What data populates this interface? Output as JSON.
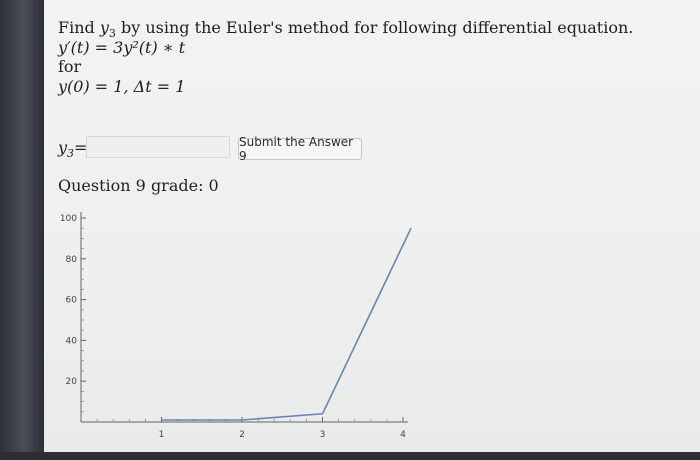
{
  "question": {
    "line1_prefix": "Find",
    "line1_var": "y",
    "line1_sub": "3",
    "line1_suffix": "by using the Euler's method for following differential equation.",
    "equation": "y′(t) = 3y²(t) ∗ t",
    "for_label": "for",
    "initial": "y(0) = 1, Δt = 1"
  },
  "answer": {
    "label_var": "y",
    "label_sub": "3",
    "label_eq": "=",
    "input_value": "",
    "submit_label": "Submit the Answer 9"
  },
  "grade_text": "Question 9 grade: 0",
  "chart_data": {
    "type": "line",
    "x_ticks": [
      "1",
      "2",
      "3",
      "4"
    ],
    "y_ticks": [
      "100",
      "80",
      "60",
      "40",
      "20"
    ],
    "series": [
      {
        "x": [
          1,
          2,
          3,
          4.1
        ],
        "y": [
          1,
          1,
          4,
          95
        ]
      }
    ],
    "xlim": [
      0,
      4
    ],
    "ylim": [
      0,
      105
    ],
    "grid": false,
    "line_color": "#6b83b8"
  },
  "colors": {
    "page_bg": "#efefef",
    "text": "#1f1f1f",
    "axis": "#666666"
  }
}
